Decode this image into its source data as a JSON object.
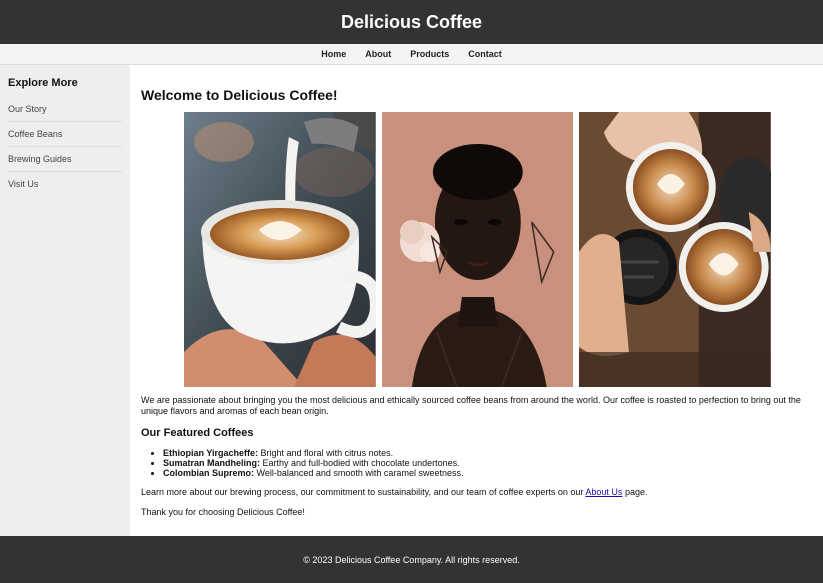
{
  "header": {
    "title": "Delicious Coffee"
  },
  "nav": {
    "items": [
      "Home",
      "About",
      "Products",
      "Contact"
    ]
  },
  "sidebar": {
    "title": "Explore More",
    "items": [
      "Our Story",
      "Coffee Beans",
      "Brewing Guides",
      "Visit Us"
    ]
  },
  "main": {
    "title": "Welcome to Delicious Coffee!",
    "intro": "We are passionate about bringing you the most delicious and ethically sourced coffee beans from around the world. Our coffee is roasted to perfection to bring out the unique flavors and aromas of each bean origin.",
    "featured_heading": "Our Featured Coffees",
    "coffees": [
      {
        "name": "Ethiopian Yirgacheffe:",
        "desc": "Bright and floral with citrus notes."
      },
      {
        "name": "Sumatran Mandheling:",
        "desc": "Earthy and full-bodied with chocolate undertones."
      },
      {
        "name": "Colombian Supremo:",
        "desc": "Well-balanced and smooth with caramel sweetness."
      }
    ],
    "learn_before": "Learn more about our brewing process, our commitment to sustainability, and our team of coffee experts on our ",
    "learn_link": "About Us",
    "learn_after": " page.",
    "thanks": "Thank you for choosing Delicious Coffee!"
  },
  "gallery": {
    "images": [
      "latte-art-pour-photo",
      "portrait-photo",
      "coffee-cups-photo"
    ]
  },
  "footer": {
    "text": "© 2023 Delicious Coffee Company. All rights reserved."
  }
}
